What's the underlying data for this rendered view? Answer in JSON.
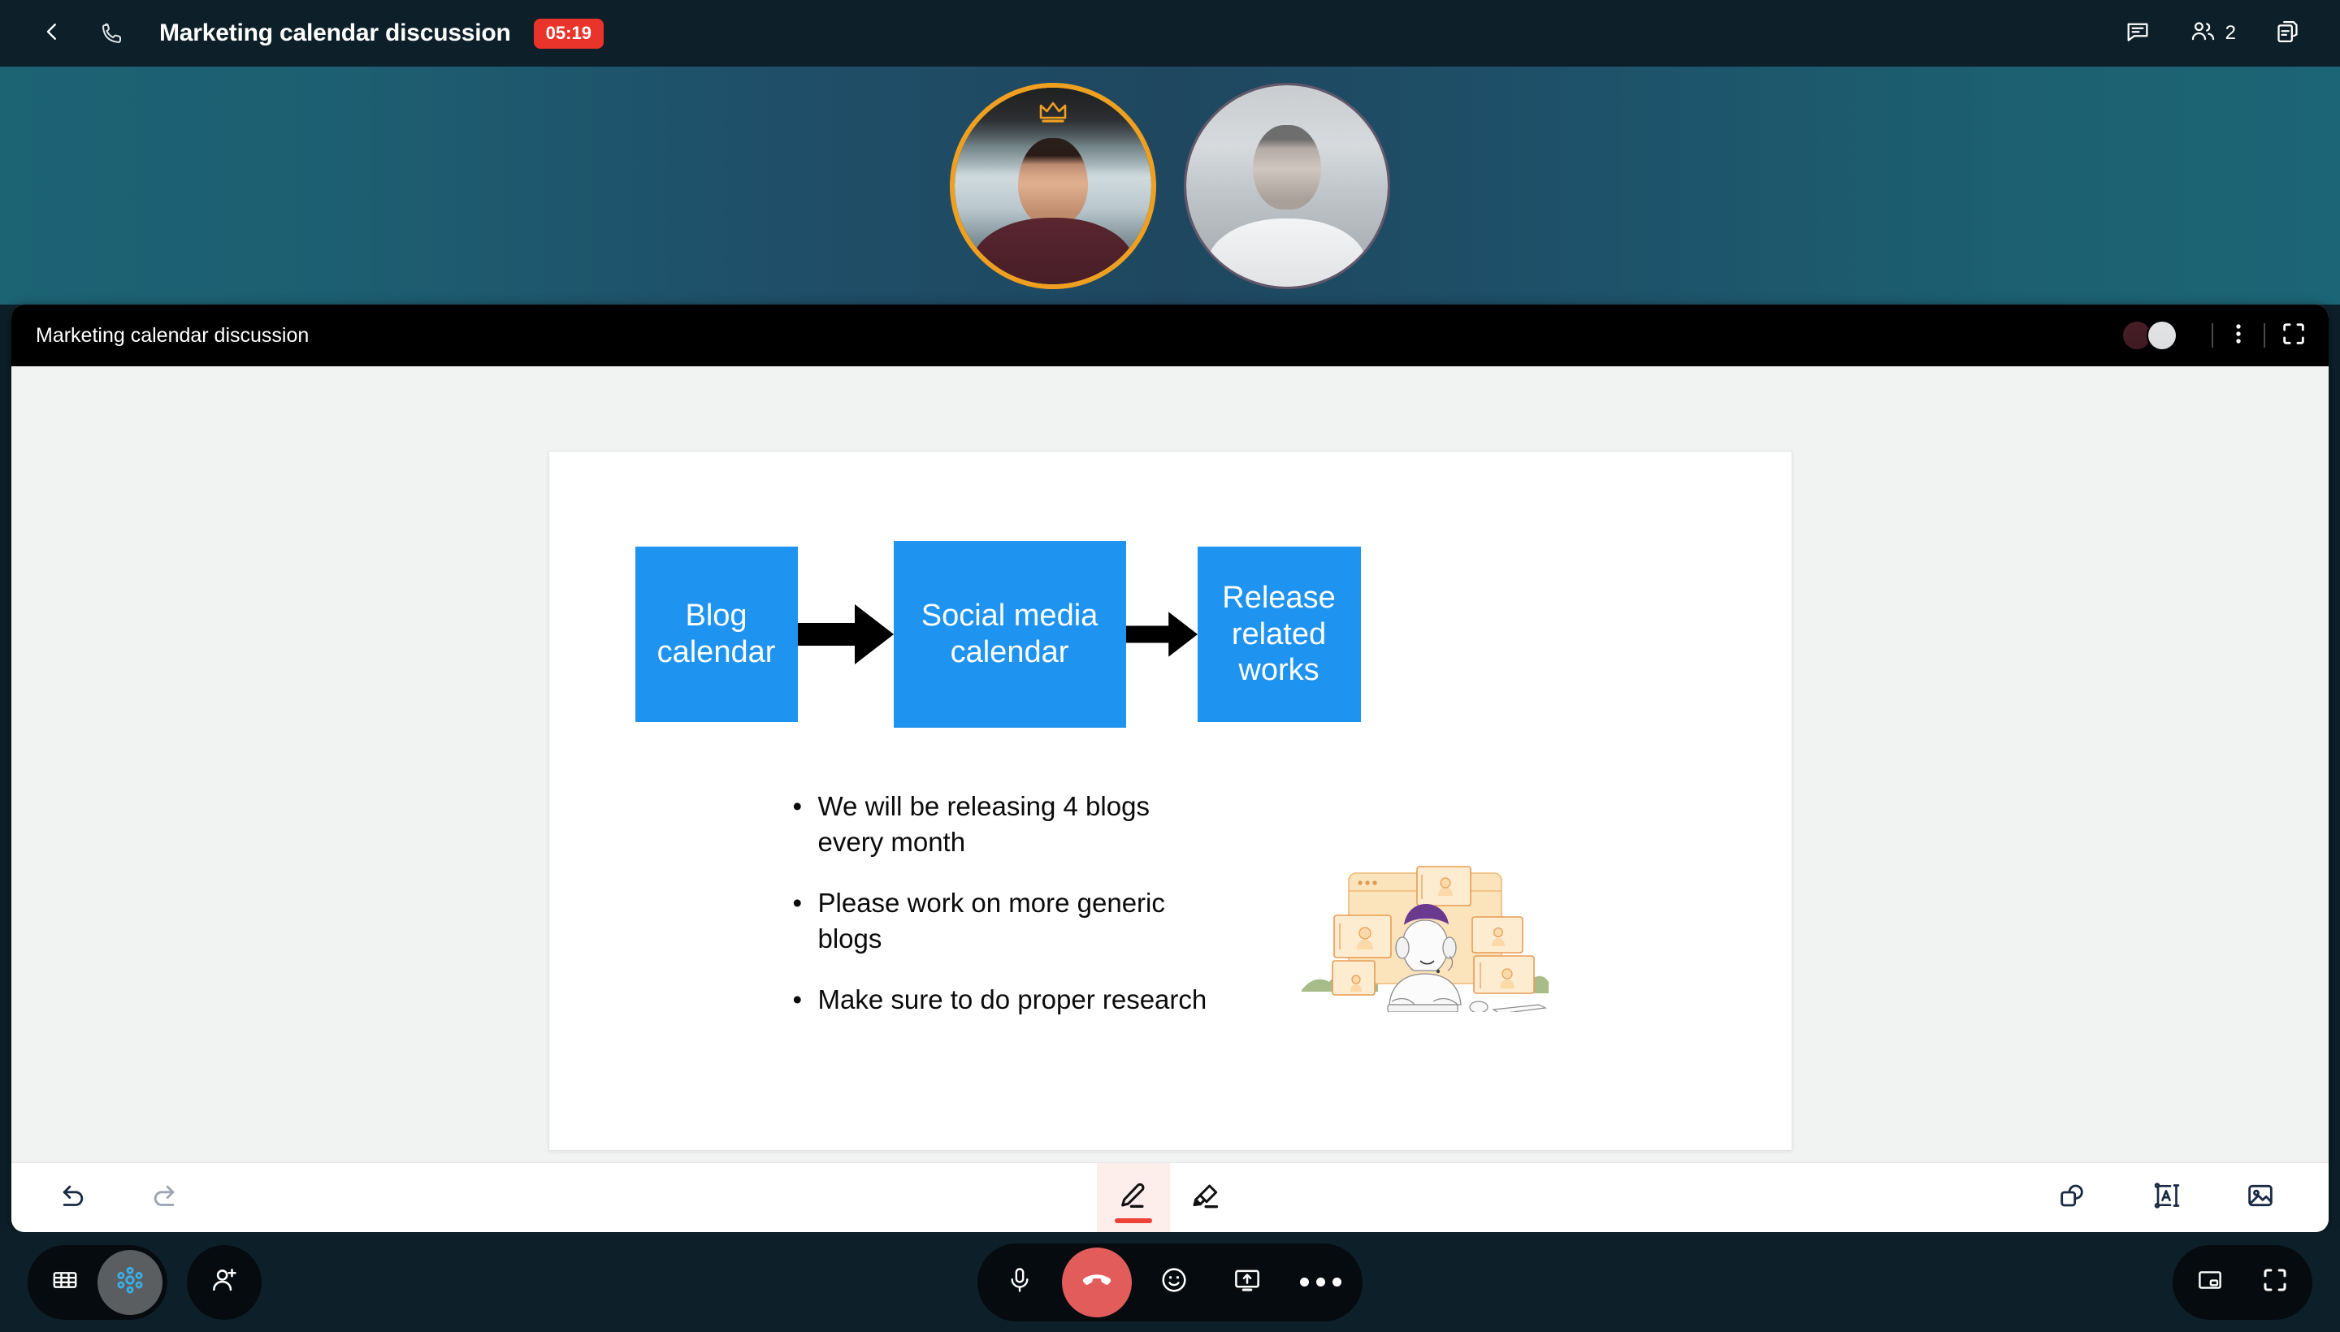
{
  "header": {
    "back_icon": "chevron-left-icon",
    "call_icon": "phone-icon",
    "title": "Marketing calendar discussion",
    "timer": "05:19",
    "chat_icon": "chat-icon",
    "people_icon": "people-icon",
    "participant_count": "2",
    "copy_icon": "copy-icon"
  },
  "stage": {
    "participants": [
      {
        "name": "participant-1",
        "role": "host",
        "badge_icon": "crown-icon",
        "ring_color": "#f0a020"
      },
      {
        "name": "participant-2",
        "role": "guest",
        "badge_icon": "",
        "ring_color": "#63576a"
      }
    ],
    "background_from": "#1c6374",
    "background_to": "#1f4760"
  },
  "whiteboard": {
    "title": "Marketing calendar discussion",
    "more_icon": "more-vertical-icon",
    "expand_icon": "expand-icon",
    "slide": {
      "flow": {
        "boxes": [
          {
            "label": "Blog calendar"
          },
          {
            "label": "Social media calendar"
          },
          {
            "label": "Release related works"
          }
        ],
        "arrow_icon": "right-arrow-shape",
        "box_color": "#1f93f0"
      },
      "bullets": [
        "We will be releasing 4 blogs every month",
        "Please work on more generic blogs",
        "Make sure to do proper research"
      ],
      "illustration": "person-with-headphones-at-desk-illustration"
    },
    "toolbar": {
      "undo_icon": "undo-icon",
      "redo_icon": "redo-icon",
      "pen_icon": "pen-icon",
      "highlighter_icon": "highlighter-icon",
      "shapes_icon": "shapes-icon",
      "text_icon": "text-box-icon",
      "image_icon": "image-icon",
      "active_tool": "pen",
      "active_color": "#ef4136"
    }
  },
  "callbar": {
    "grid_icon": "grid-view-icon",
    "cluster_icon": "together-mode-icon",
    "add_person_icon": "add-person-icon",
    "mic_icon": "microphone-icon",
    "hangup_icon": "end-call-icon",
    "reaction_icon": "emoji-icon",
    "share_icon": "share-screen-icon",
    "more_icon": "more-horizontal-icon",
    "pip_icon": "picture-in-picture-icon",
    "fullscreen_icon": "fullscreen-icon",
    "hangup_color": "#e35c5c",
    "cluster_active_color": "#3ab0e8"
  }
}
